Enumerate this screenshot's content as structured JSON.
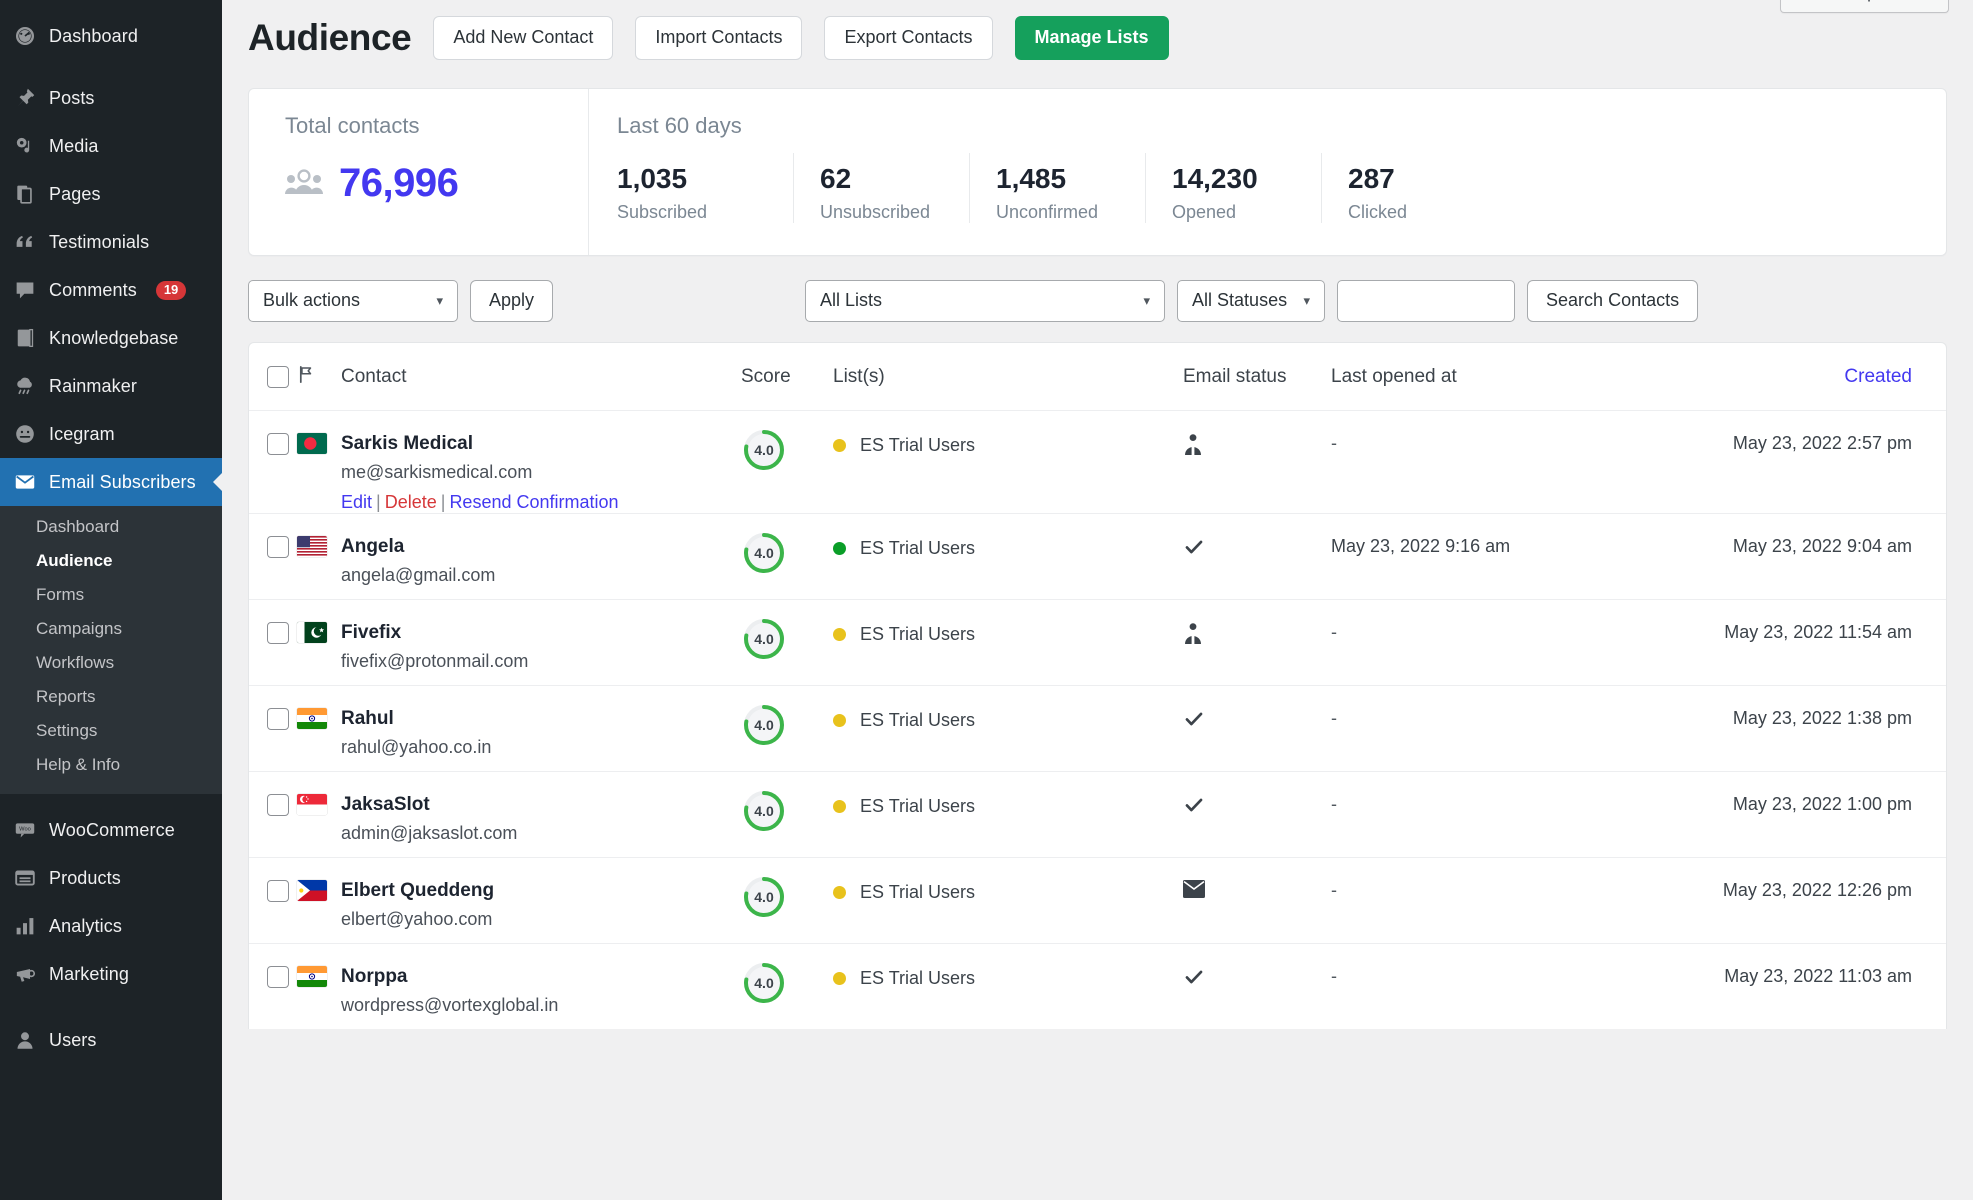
{
  "sidebar": {
    "items": [
      {
        "label": "Dashboard",
        "icon": "dashboard-icon"
      },
      {
        "label": "Posts",
        "icon": "pin-icon"
      },
      {
        "label": "Media",
        "icon": "media-icon"
      },
      {
        "label": "Pages",
        "icon": "pages-icon"
      },
      {
        "label": "Testimonials",
        "icon": "quote-icon"
      },
      {
        "label": "Comments",
        "icon": "comment-icon",
        "badge": "19"
      },
      {
        "label": "Knowledgebase",
        "icon": "book-icon"
      },
      {
        "label": "Rainmaker",
        "icon": "cloud-rain-icon"
      },
      {
        "label": "Icegram",
        "icon": "icegram-icon"
      },
      {
        "label": "Email Subscribers",
        "icon": "envelope-icon",
        "current": true
      }
    ],
    "submenu": [
      {
        "label": "Dashboard"
      },
      {
        "label": "Audience",
        "active": true
      },
      {
        "label": "Forms"
      },
      {
        "label": "Campaigns"
      },
      {
        "label": "Workflows"
      },
      {
        "label": "Reports"
      },
      {
        "label": "Settings"
      },
      {
        "label": "Help & Info"
      }
    ],
    "items_bottom": [
      {
        "label": "WooCommerce",
        "icon": "woocommerce-icon"
      },
      {
        "label": "Products",
        "icon": "products-icon"
      },
      {
        "label": "Analytics",
        "icon": "analytics-icon"
      },
      {
        "label": "Marketing",
        "icon": "megaphone-icon"
      },
      {
        "label": "Users",
        "icon": "users-icon"
      }
    ]
  },
  "header": {
    "screen_options": "Screen Options ▼",
    "title": "Audience",
    "buttons": [
      {
        "label": "Add New Contact",
        "style": "default"
      },
      {
        "label": "Import Contacts",
        "style": "default"
      },
      {
        "label": "Export Contacts",
        "style": "default"
      },
      {
        "label": "Manage Lists",
        "style": "primary"
      }
    ]
  },
  "stats": {
    "total_label": "Total contacts",
    "total_value": "76,996",
    "total_color": "#4338f0",
    "period_label": "Last 60 days",
    "cells": [
      {
        "value": "1,035",
        "label": "Subscribed"
      },
      {
        "value": "62",
        "label": "Unsubscribed"
      },
      {
        "value": "1,485",
        "label": "Unconfirmed"
      },
      {
        "value": "14,230",
        "label": "Opened"
      },
      {
        "value": "287",
        "label": "Clicked"
      }
    ]
  },
  "toolbar": {
    "bulk_actions": "Bulk actions",
    "apply": "Apply",
    "all_lists": "All Lists",
    "all_statuses": "All Statuses",
    "search_value": "",
    "search_placeholder": "",
    "search_button": "Search Contacts"
  },
  "table": {
    "columns": {
      "contact": "Contact",
      "score": "Score",
      "lists": "List(s)",
      "email_status": "Email status",
      "last_opened": "Last opened at",
      "created": "Created"
    },
    "rows": [
      {
        "name": "Sarkis Medical",
        "email": "me@sarkismedical.com",
        "flag": "bangladesh",
        "score": "4.0",
        "list": "ES Trial Users",
        "dot": "#e8c21c",
        "status_icon": "person-icon",
        "last_opened": "-",
        "created": "May 23, 2022 2:57 pm",
        "actions": {
          "edit": "Edit",
          "delete": "Delete",
          "resend": "Resend Confirmation"
        }
      },
      {
        "name": "Angela",
        "email": "angela@gmail.com",
        "flag": "usa",
        "score": "4.0",
        "list": "ES Trial Users",
        "dot": "#0a9e28",
        "status_icon": "check-icon",
        "last_opened": "May 23, 2022 9:16 am",
        "created": "May 23, 2022 9:04 am"
      },
      {
        "name": "Fivefix",
        "email": "fivefix@protonmail.com",
        "flag": "pakistan",
        "score": "4.0",
        "list": "ES Trial Users",
        "dot": "#e8c21c",
        "status_icon": "person-icon",
        "last_opened": "-",
        "created": "May 23, 2022 11:54 am"
      },
      {
        "name": "Rahul",
        "email": "rahul@yahoo.co.in",
        "flag": "india",
        "score": "4.0",
        "list": "ES Trial Users",
        "dot": "#e8c21c",
        "status_icon": "check-icon",
        "last_opened": "-",
        "created": "May 23, 2022 1:38 pm"
      },
      {
        "name": "JaksaSlot",
        "email": "admin@jaksaslot.com",
        "flag": "singapore",
        "score": "4.0",
        "list": "ES Trial Users",
        "dot": "#e8c21c",
        "status_icon": "check-icon",
        "last_opened": "-",
        "created": "May 23, 2022 1:00 pm"
      },
      {
        "name": "Elbert Queddeng",
        "email": "elbert@yahoo.com",
        "flag": "philippines",
        "score": "4.0",
        "list": "ES Trial Users",
        "dot": "#e8c21c",
        "status_icon": "envelope-icon",
        "last_opened": "-",
        "created": "May 23, 2022 12:26 pm"
      },
      {
        "name": "Norppa",
        "email": "wordpress@vortexglobal.in",
        "flag": "india",
        "score": "4.0",
        "list": "ES Trial Users",
        "dot": "#e8c21c",
        "status_icon": "check-icon",
        "last_opened": "-",
        "created": "May 23, 2022 11:03 am"
      }
    ]
  }
}
